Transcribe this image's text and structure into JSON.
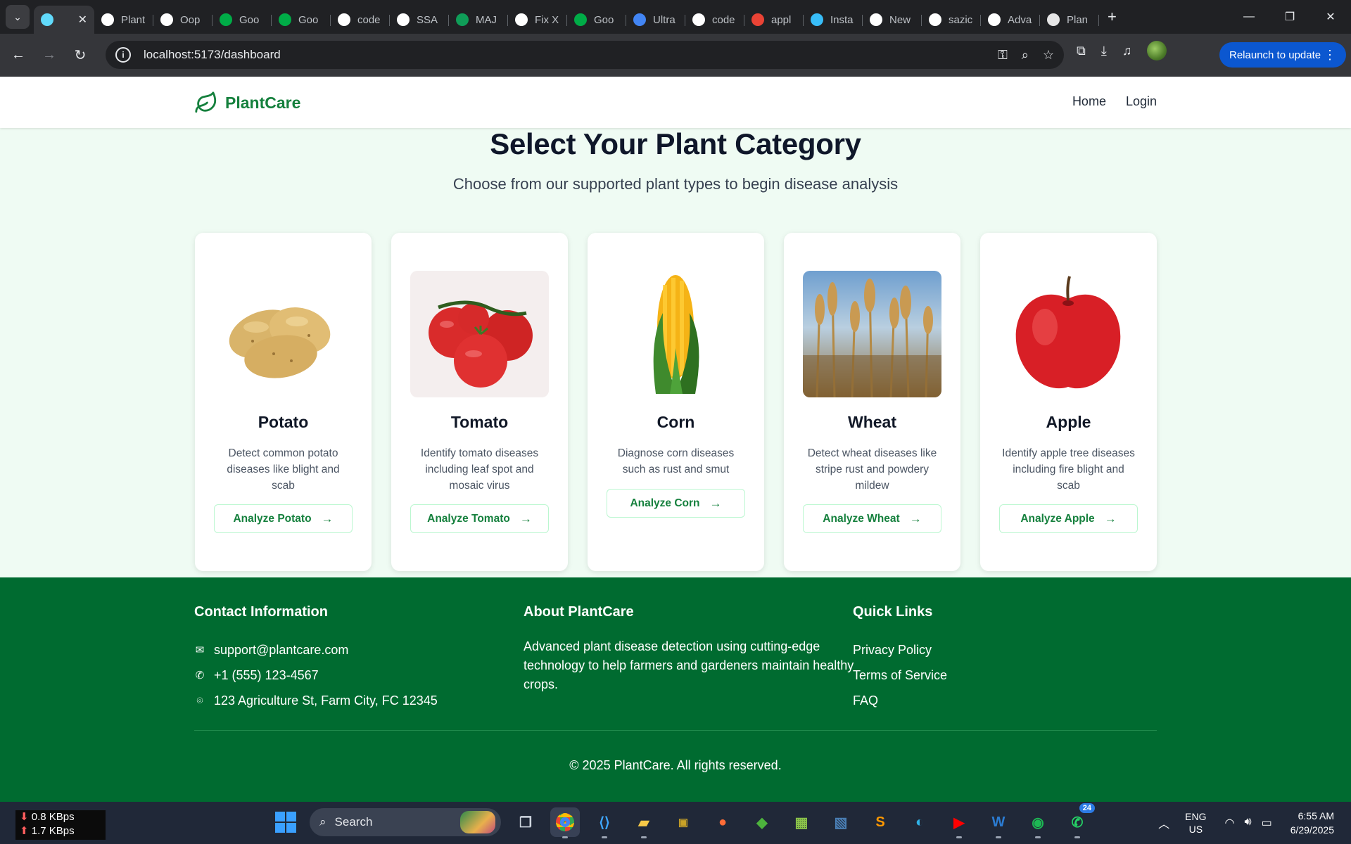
{
  "browser": {
    "tabs": [
      {
        "title": "",
        "icon": "react-icon",
        "color": "#61dafb",
        "active": true
      },
      {
        "title": "Plant",
        "icon": "openai-icon",
        "color": "#ffffff"
      },
      {
        "title": "Oop",
        "icon": "openai-icon",
        "color": "#ffffff"
      },
      {
        "title": "Goo",
        "icon": "google-meet-icon",
        "color": "#00ac47"
      },
      {
        "title": "Goo",
        "icon": "google-meet-icon",
        "color": "#00ac47"
      },
      {
        "title": "code",
        "icon": "github-icon",
        "color": "#ffffff"
      },
      {
        "title": "SSA",
        "icon": "github-icon",
        "color": "#ffffff"
      },
      {
        "title": "MAJ",
        "icon": "sheets-icon",
        "color": "#0f9d58"
      },
      {
        "title": "Fix X",
        "icon": "openai-icon",
        "color": "#ffffff"
      },
      {
        "title": "Goo",
        "icon": "google-meet-icon",
        "color": "#00ac47"
      },
      {
        "title": "Ultra",
        "icon": "ultra-icon",
        "color": "#4285f4"
      },
      {
        "title": "code",
        "icon": "github-icon",
        "color": "#ffffff"
      },
      {
        "title": "appl",
        "icon": "google-icon",
        "color": "#ea4335"
      },
      {
        "title": "Insta",
        "icon": "tailwind-icon",
        "color": "#38bdf8"
      },
      {
        "title": "New",
        "icon": "chrome-icon",
        "color": "#ffffff"
      },
      {
        "title": "sazic",
        "icon": "github-icon",
        "color": "#ffffff"
      },
      {
        "title": "Adva",
        "icon": "github-icon",
        "color": "#ffffff"
      },
      {
        "title": "Plan",
        "icon": "plant-favicon-icon",
        "color": "#e6e6e6"
      }
    ],
    "url": "localhost:5173/dashboard",
    "relaunch_label": "Relaunch to update"
  },
  "app": {
    "brand": "PlantCare",
    "nav": {
      "home": "Home",
      "login": "Login"
    },
    "hero": {
      "title": "Select Your Plant Category",
      "subtitle": "Choose from our supported plant types to begin disease analysis"
    },
    "cards": [
      {
        "name": "Potato",
        "description": "Detect common potato diseases like blight and scab",
        "button": "Analyze Potato"
      },
      {
        "name": "Tomato",
        "description": "Identify tomato diseases including leaf spot and mosaic virus",
        "button": "Analyze Tomato"
      },
      {
        "name": "Corn",
        "description": "Diagnose corn diseases such as rust and smut",
        "button": "Analyze Corn"
      },
      {
        "name": "Wheat",
        "description": "Detect wheat diseases like stripe rust and powdery mildew",
        "button": "Analyze Wheat"
      },
      {
        "name": "Apple",
        "description": "Identify apple tree diseases including fire blight and scab",
        "button": "Analyze Apple"
      }
    ],
    "footer": {
      "contact": {
        "heading": "Contact Information",
        "email": "support@plantcare.com",
        "phone": "+1 (555) 123-4567",
        "address": "123 Agriculture St, Farm City, FC 12345"
      },
      "about": {
        "heading": "About PlantCare",
        "text": "Advanced plant disease detection using cutting-edge technology to help farmers and gardeners maintain healthy crops."
      },
      "links": {
        "heading": "Quick Links",
        "items": [
          "Privacy Policy",
          "Terms of Service",
          "FAQ"
        ]
      },
      "copyright": "© 2025 PlantCare. All rights reserved."
    },
    "colors": {
      "brand_green": "#15803d",
      "footer_green": "#006b30",
      "page_bg": "#effbf3"
    }
  },
  "taskbar": {
    "net_down": "0.8 KBps",
    "net_up": "1.7 KBps",
    "search_placeholder": "Search",
    "whatsapp_badge": "24",
    "lang_top": "ENG",
    "lang_bottom": "US",
    "time": "6:55 AM",
    "date": "6/29/2025"
  }
}
